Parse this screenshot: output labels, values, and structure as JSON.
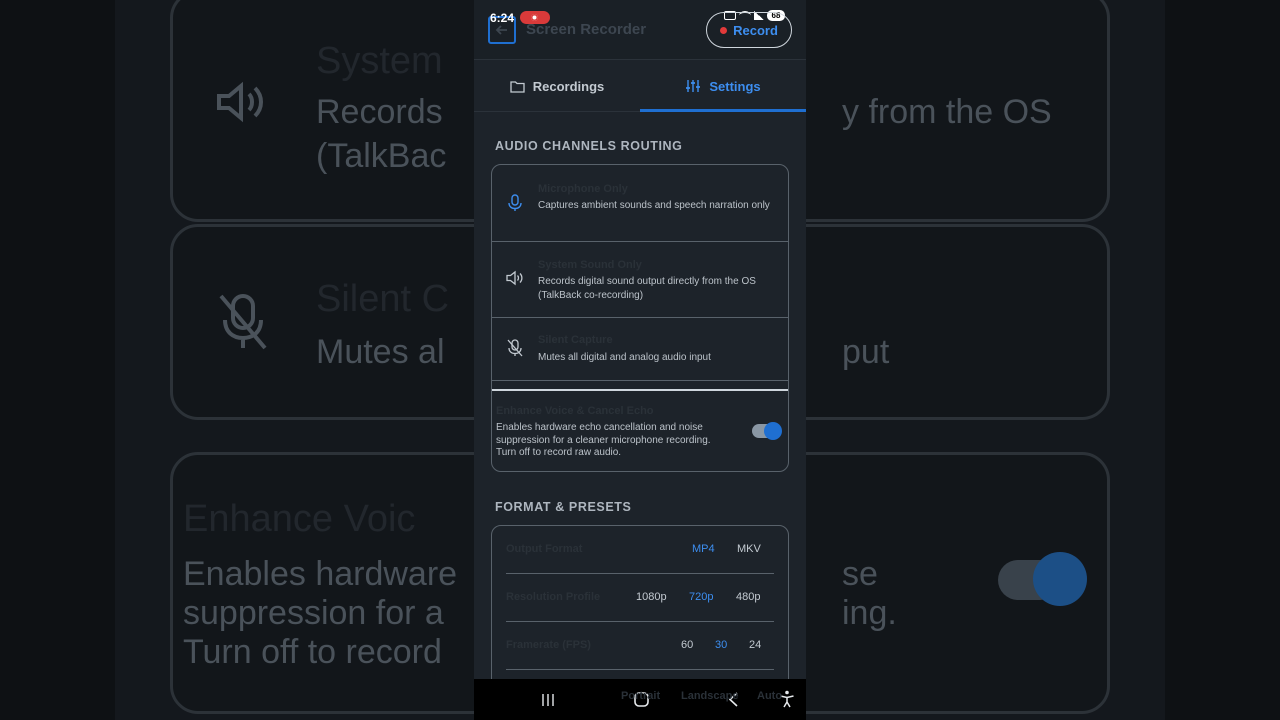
{
  "status_bar": {
    "time": "6:24",
    "battery": "68"
  },
  "app_bar": {
    "title": "Screen Recorder",
    "record_label": "Record"
  },
  "tabs": [
    {
      "label": "Recordings",
      "icon": "folder-icon",
      "active": false
    },
    {
      "label": "Settings",
      "icon": "sliders-icon",
      "active": true
    }
  ],
  "audio": {
    "section_title": "AUDIO CHANNELS ROUTING",
    "options": [
      {
        "title": "Microphone Only",
        "description": "Captures ambient sounds and speech narration only",
        "icon": "microphone-icon"
      },
      {
        "title": "System Sound Only",
        "description": "Records digital sound output directly from the OS (TalkBack co-recording)",
        "icon": "speaker-icon"
      },
      {
        "title": "Silent Capture",
        "description": "Mutes all digital and analog audio input",
        "icon": "mic-off-icon"
      }
    ],
    "echo": {
      "title": "Enhance Voice & Cancel Echo",
      "description": "Enables hardware echo cancellation and noise suppression for a cleaner microphone recording. Turn off to record raw audio.",
      "enabled": true
    }
  },
  "format": {
    "section_title": "FORMAT & PRESETS",
    "rows": [
      {
        "label": "Output Format",
        "options": [
          "MP4",
          "MKV"
        ],
        "selected": "MP4"
      },
      {
        "label": "Resolution Profile",
        "options": [
          "1080p",
          "720p",
          "480p"
        ],
        "selected": "720p"
      },
      {
        "label": "Framerate (FPS)",
        "options": [
          "60",
          "30",
          "24"
        ],
        "selected": "30"
      }
    ],
    "partial_row": {
      "options": [
        "Portrait",
        "Landscape",
        "Auto"
      ]
    }
  },
  "backdrop": {
    "title_1": "System",
    "text_1a": "Records",
    "text_1b": "y from the OS",
    "text_1c": "(TalkBac",
    "title_2": "Silent C",
    "text_2a": "Mutes al",
    "text_2b": "put",
    "title_3": "Enhance Voic",
    "text_3a": "Enables hardware",
    "text_3b": "se",
    "text_3c": "suppression for a",
    "text_3d": "ing.",
    "text_3e": "Turn off to record"
  },
  "colors": {
    "accent": "#1f6fd1",
    "accent_text": "#3d8ef0",
    "record_dot": "#e23a3a",
    "background": "#1d232a"
  }
}
